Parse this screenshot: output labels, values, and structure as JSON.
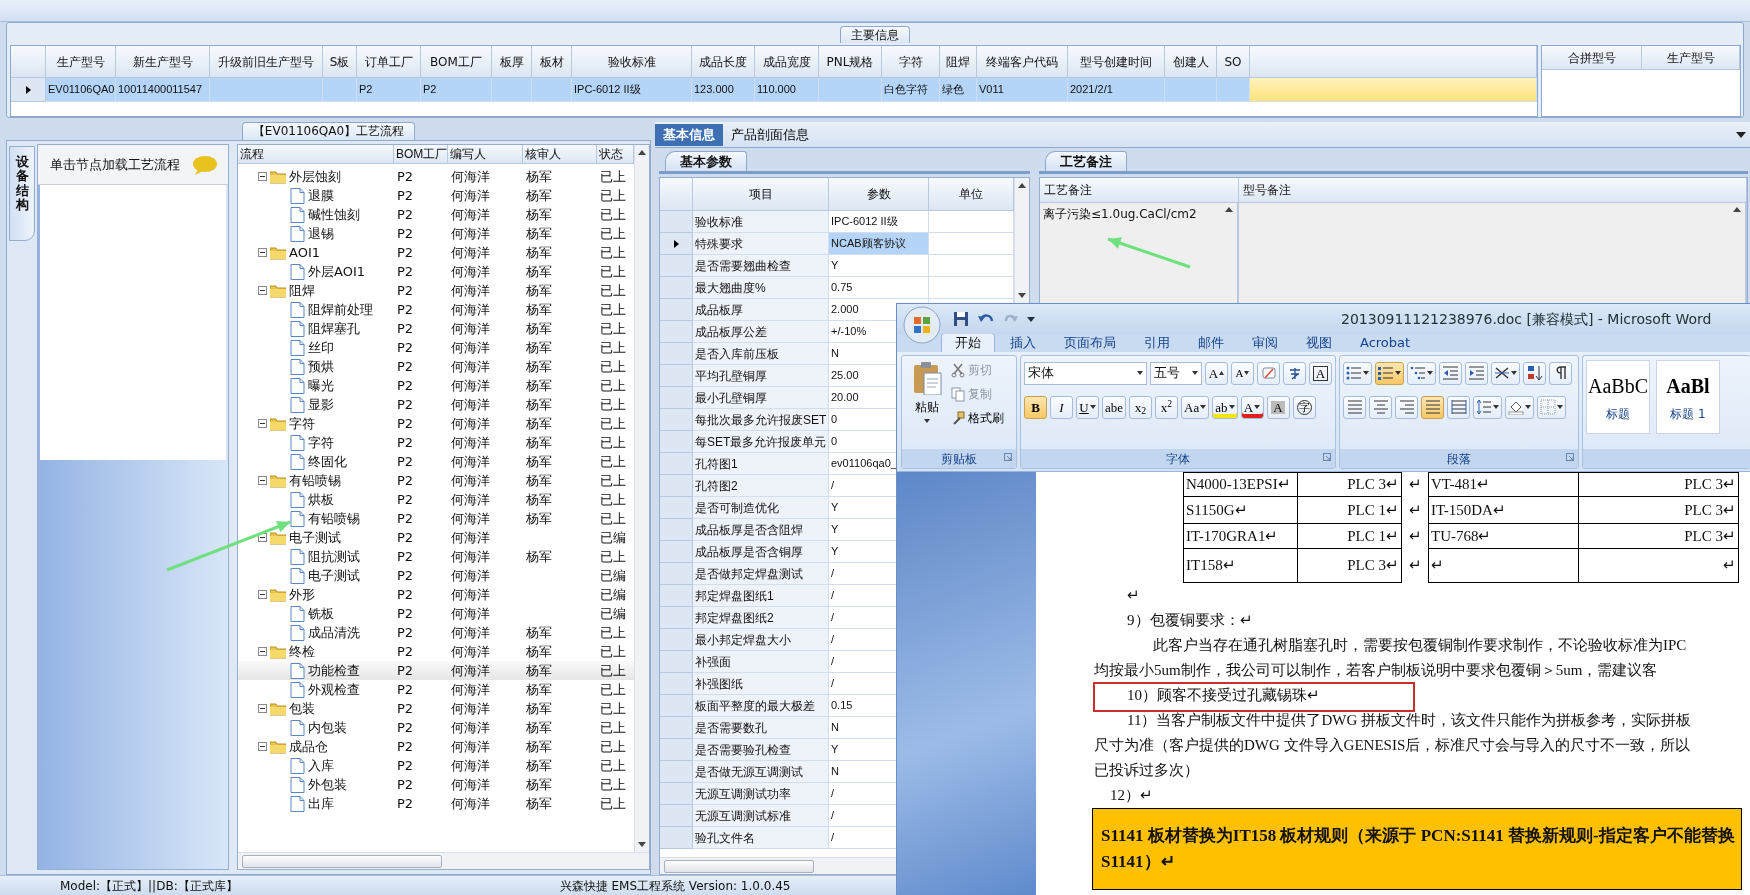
{
  "main_info": {
    "title": "主要信息",
    "row_selected": true,
    "columns": [
      {
        "label": "生产型号",
        "value": "EV01106QA0"
      },
      {
        "label": "新生产型号",
        "value": "10011400011547"
      },
      {
        "label": "升级前旧生产型号"
      },
      {
        "label": "S板"
      },
      {
        "label": "订单工厂",
        "value": "P2"
      },
      {
        "label": "BOM工厂",
        "value": "P2"
      },
      {
        "label": "板厚"
      },
      {
        "label": "板材"
      },
      {
        "label": "验收标准",
        "value": "IPC-6012 II级"
      },
      {
        "label": "成品长度",
        "value": "123.000"
      },
      {
        "label": "成品宽度",
        "value": "110.000"
      },
      {
        "label": "PNL规格"
      },
      {
        "label": "字符",
        "value": "白色字符"
      },
      {
        "label": "阻焊",
        "value": "绿色"
      },
      {
        "label": "终端客户代码",
        "value": "V011"
      },
      {
        "label": "型号创建时间",
        "value": "2021/2/1"
      },
      {
        "label": "创建人"
      },
      {
        "label": "SO"
      }
    ],
    "merge_grid": {
      "columns": [
        "合拼型号",
        "生产型号"
      ]
    }
  },
  "flow": {
    "title": "【EV01106QA0】工艺流程",
    "side_tab": "设备结构",
    "hint": "单击节点加载工艺流程",
    "columns": [
      "流程",
      "BOM工厂",
      "编写人",
      "核审人",
      "状态"
    ],
    "rows": [
      {
        "name": "外层蚀刻",
        "bom": "P2",
        "writer": "何海洋",
        "reviewer": "杨军",
        "status": "已上",
        "selected": false,
        "expanded": true,
        "children": [
          {
            "name": "退膜",
            "bom": "P2",
            "writer": "何海洋",
            "reviewer": "杨军",
            "status": "已上",
            "selected": false
          },
          {
            "name": "碱性蚀刻",
            "bom": "P2",
            "writer": "何海洋",
            "reviewer": "杨军",
            "status": "已上",
            "selected": false
          },
          {
            "name": "退锡",
            "bom": "P2",
            "writer": "何海洋",
            "reviewer": "杨军",
            "status": "已上",
            "selected": false
          }
        ]
      },
      {
        "name": "AOI1",
        "bom": "P2",
        "writer": "何海洋",
        "reviewer": "杨军",
        "status": "已上",
        "selected": false,
        "expanded": true,
        "children": [
          {
            "name": "外层AOI1",
            "bom": "P2",
            "writer": "何海洋",
            "reviewer": "杨军",
            "status": "已上",
            "selected": false
          }
        ]
      },
      {
        "name": "阻焊",
        "bom": "P2",
        "writer": "何海洋",
        "reviewer": "杨军",
        "status": "已上",
        "selected": false,
        "expanded": true,
        "children": [
          {
            "name": "阻焊前处理",
            "bom": "P2",
            "writer": "何海洋",
            "reviewer": "杨军",
            "status": "已上",
            "selected": false
          },
          {
            "name": "阻焊塞孔",
            "bom": "P2",
            "writer": "何海洋",
            "reviewer": "杨军",
            "status": "已上",
            "selected": false
          },
          {
            "name": "丝印",
            "bom": "P2",
            "writer": "何海洋",
            "reviewer": "杨军",
            "status": "已上",
            "selected": false
          },
          {
            "name": "预烘",
            "bom": "P2",
            "writer": "何海洋",
            "reviewer": "杨军",
            "status": "已上",
            "selected": false
          },
          {
            "name": "曝光",
            "bom": "P2",
            "writer": "何海洋",
            "reviewer": "杨军",
            "status": "已上",
            "selected": false
          },
          {
            "name": "显影",
            "bom": "P2",
            "writer": "何海洋",
            "reviewer": "杨军",
            "status": "已上",
            "selected": false
          }
        ]
      },
      {
        "name": "字符",
        "bom": "P2",
        "writer": "何海洋",
        "reviewer": "杨军",
        "status": "已上",
        "selected": false,
        "expanded": true,
        "children": [
          {
            "name": "字符",
            "bom": "P2",
            "writer": "何海洋",
            "reviewer": "杨军",
            "status": "已上",
            "selected": false
          },
          {
            "name": "终固化",
            "bom": "P2",
            "writer": "何海洋",
            "reviewer": "杨军",
            "status": "已上",
            "selected": false
          }
        ]
      },
      {
        "name": "有铅喷锡",
        "bom": "P2",
        "writer": "何海洋",
        "reviewer": "杨军",
        "status": "已上",
        "selected": false,
        "expanded": true,
        "children": [
          {
            "name": "烘板",
            "bom": "P2",
            "writer": "何海洋",
            "reviewer": "杨军",
            "status": "已上",
            "selected": false
          },
          {
            "name": "有铅喷锡",
            "bom": "P2",
            "writer": "何海洋",
            "reviewer": "杨军",
            "status": "已上",
            "selected": false
          }
        ]
      },
      {
        "name": "电子测试",
        "bom": "P2",
        "writer": "何海洋",
        "status": "已编",
        "selected": false,
        "expanded": true,
        "children": [
          {
            "name": "阻抗测试",
            "bom": "P2",
            "writer": "何海洋",
            "reviewer": "杨军",
            "status": "已上",
            "selected": false
          },
          {
            "name": "电子测试",
            "bom": "P2",
            "writer": "何海洋",
            "status": "已编",
            "selected": false
          }
        ]
      },
      {
        "name": "外形",
        "bom": "P2",
        "writer": "何海洋",
        "status": "已编",
        "selected": false,
        "expanded": true,
        "children": [
          {
            "name": "铣板",
            "bom": "P2",
            "writer": "何海洋",
            "status": "已编",
            "selected": false
          },
          {
            "name": "成品清洗",
            "bom": "P2",
            "writer": "何海洋",
            "reviewer": "杨军",
            "status": "已上",
            "selected": false
          }
        ]
      },
      {
        "name": "终检",
        "bom": "P2",
        "writer": "何海洋",
        "reviewer": "杨军",
        "status": "已上",
        "selected": false,
        "expanded": true,
        "children": [
          {
            "name": "功能检查",
            "bom": "P2",
            "writer": "何海洋",
            "reviewer": "杨军",
            "status": "已上",
            "selected": true
          },
          {
            "name": "外观检查",
            "bom": "P2",
            "writer": "何海洋",
            "reviewer": "杨军",
            "status": "已上",
            "selected": false
          }
        ]
      },
      {
        "name": "包装",
        "bom": "P2",
        "writer": "何海洋",
        "reviewer": "杨军",
        "status": "已上",
        "selected": false,
        "expanded": true,
        "children": [
          {
            "name": "内包装",
            "bom": "P2",
            "writer": "何海洋",
            "reviewer": "杨军",
            "status": "已上",
            "selected": false
          }
        ]
      },
      {
        "name": "成品仓",
        "bom": "P2",
        "writer": "何海洋",
        "reviewer": "杨军",
        "status": "已上",
        "selected": false,
        "expanded": true,
        "children": [
          {
            "name": "入库",
            "bom": "P2",
            "writer": "何海洋",
            "reviewer": "杨军",
            "status": "已上",
            "selected": false
          },
          {
            "name": "外包装",
            "bom": "P2",
            "writer": "何海洋",
            "reviewer": "杨军",
            "status": "已上",
            "selected": false
          },
          {
            "name": "出库",
            "bom": "P2",
            "writer": "何海洋",
            "reviewer": "杨军",
            "status": "已上",
            "selected": false
          }
        ]
      }
    ]
  },
  "params": {
    "tabs": [
      {
        "label": "基本信息",
        "selected": true
      },
      {
        "label": "产品剖面信息",
        "selected": false
      }
    ],
    "subtab": "基本参数",
    "columns": [
      "项目",
      "参数",
      "单位"
    ],
    "rows": [
      {
        "item": "验收标准",
        "value": "IPC-6012 II级",
        "selected": false
      },
      {
        "item": "特殊要求",
        "value": "NCAB顾客协议",
        "selected": true
      },
      {
        "item": "是否需要翘曲检查",
        "value": "Y",
        "selected": false
      },
      {
        "item": "最大翘曲度%",
        "value": "0.75",
        "selected": false
      },
      {
        "item": "成品板厚",
        "value": "2.000",
        "selected": false
      },
      {
        "item": "成品板厚公差",
        "value": "+/-10%",
        "selected": false
      },
      {
        "item": "是否入库前压板",
        "value": "N",
        "selected": false
      },
      {
        "item": "平均孔壁铜厚",
        "value": "25.00",
        "selected": false
      },
      {
        "item": "最小孔壁铜厚",
        "value": "20.00",
        "selected": false
      },
      {
        "item": "每批次最多允许报废SET",
        "value": "0",
        "selected": false
      },
      {
        "item": "每SET最多允许报废单元",
        "value": "0",
        "selected": false
      },
      {
        "item": "孔符图1",
        "value": "ev01106qa0_",
        "selected": false
      },
      {
        "item": "孔符图2",
        "value": "/",
        "selected": false
      },
      {
        "item": "是否可制造优化",
        "value": "Y",
        "selected": false
      },
      {
        "item": "成品板厚是否含阻焊",
        "value": "Y",
        "selected": false
      },
      {
        "item": "成品板厚是否含铜厚",
        "value": "Y",
        "selected": false
      },
      {
        "item": "是否做邦定焊盘测试",
        "value": "/",
        "selected": false
      },
      {
        "item": "邦定焊盘图纸1",
        "value": "/",
        "selected": false
      },
      {
        "item": "邦定焊盘图纸2",
        "value": "/",
        "selected": false
      },
      {
        "item": "最小邦定焊盘大小",
        "value": "/",
        "selected": false
      },
      {
        "item": "补强面",
        "value": "/",
        "selected": false
      },
      {
        "item": "补强图纸",
        "value": "/",
        "selected": false
      },
      {
        "item": "板面平整度的最大极差",
        "value": "0.15",
        "selected": false
      },
      {
        "item": "是否需要数孔",
        "value": "N",
        "selected": false
      },
      {
        "item": "是否需要验孔检查",
        "value": "Y",
        "selected": false
      },
      {
        "item": "是否做无源互调测试",
        "value": "N",
        "selected": false
      },
      {
        "item": "无源互调测试功率",
        "value": "/",
        "selected": false
      },
      {
        "item": "无源互调测试标准",
        "value": "/",
        "selected": false
      },
      {
        "item": "验孔文件名",
        "value": "/",
        "selected": false
      }
    ]
  },
  "notes": {
    "tab": "工艺备注",
    "columns": [
      "工艺备注",
      "型号备注"
    ],
    "process_note": "离子污染≤1.0ug.CaCl/cm2"
  },
  "status_bar": {
    "left": "Model:【正式】||DB:【正式库】",
    "center": "兴森快捷 EMS工程系统 Version: 1.0.0.45"
  },
  "word": {
    "title": "20130911121238976.doc [兼容模式] - Microsoft Word",
    "tabs": [
      {
        "label": "开始",
        "selected": true
      },
      {
        "label": "插入",
        "selected": false
      },
      {
        "label": "页面布局",
        "selected": false
      },
      {
        "label": "引用",
        "selected": false
      },
      {
        "label": "邮件",
        "selected": false
      },
      {
        "label": "审阅",
        "selected": false
      },
      {
        "label": "视图",
        "selected": false
      },
      {
        "label": "Acrobat",
        "selected": false
      }
    ],
    "groups": [
      "剪贴板",
      "字体",
      "段落"
    ],
    "clipboard": {
      "paste": "粘贴",
      "items": [
        {
          "kind": "cut",
          "label": "剪切",
          "disabled": true
        },
        {
          "kind": "copy",
          "label": "复制",
          "disabled": true
        },
        {
          "kind": "format-painter",
          "label": "格式刷",
          "disabled": false
        }
      ]
    },
    "font": {
      "name": "宋体",
      "size": "五号",
      "row1": [
        {
          "kind": "grow-font",
          "label": "A",
          "on": false
        },
        {
          "kind": "shrink-font",
          "label": "A",
          "on": false
        },
        {
          "kind": "clear-format",
          "on": false
        },
        {
          "kind": "phonetic-guide",
          "on": false
        },
        {
          "kind": "character-border",
          "label": "A",
          "on": false
        }
      ],
      "row2": [
        {
          "kind": "bold",
          "label": "B",
          "on": true
        },
        {
          "kind": "italic",
          "label": "I",
          "on": false
        },
        {
          "kind": "underline",
          "label": "U",
          "on": false
        },
        {
          "kind": "strikethrough",
          "label": "abe",
          "on": false
        },
        {
          "kind": "subscript",
          "label": "x$_{2}$",
          "on": false
        },
        {
          "kind": "superscript",
          "label": "x$^{2}$",
          "on": false
        },
        {
          "kind": "change-case",
          "label": "Aa",
          "on": false
        },
        {
          "kind": "highlight",
          "label": "ab",
          "on": false
        },
        {
          "kind": "font-color",
          "label": "A",
          "on": false
        },
        {
          "kind": "character-shading",
          "label": "A",
          "on": false
        },
        {
          "kind": "enclose-characters",
          "label": "字",
          "on": false
        }
      ]
    },
    "paragraph": {
      "row1": [
        {
          "kind": "bullets",
          "on": false
        },
        {
          "kind": "numbering",
          "on": true
        },
        {
          "kind": "multilevel-list",
          "on": false
        },
        {
          "kind": "decrease-indent",
          "on": false
        },
        {
          "kind": "increase-indent",
          "on": false
        },
        {
          "kind": "chinese-layout",
          "on": false
        },
        {
          "kind": "sort",
          "on": false
        },
        {
          "kind": "show-marks",
          "on": false
        }
      ],
      "row2": [
        {
          "kind": "align-left",
          "on": false
        },
        {
          "kind": "align-center",
          "on": false
        },
        {
          "kind": "align-right",
          "on": false
        },
        {
          "kind": "justify",
          "on": true
        },
        {
          "kind": "distributed",
          "on": false
        },
        {
          "kind": "line-spacing",
          "on": false
        },
        {
          "kind": "shading",
          "on": false
        },
        {
          "kind": "borders",
          "on": false
        }
      ]
    },
    "styles": [
      {
        "sample": "AaBbC",
        "label": "标题"
      },
      {
        "sample": "AaBl",
        "label": "标题 1"
      }
    ],
    "doc": {
      "table_rows": [
        [
          "N4000-13EPSI↵",
          "PLC 3↵",
          "↵",
          "VT-481↵",
          "PLC 3↵"
        ],
        [
          "S1150G↵",
          "PLC 1↵",
          "↵",
          "IT-150DA↵",
          "PLC 3↵"
        ],
        [
          "IT-170GRA1↵",
          "PLC 1↵",
          "↵",
          "TU-768↵",
          "PLC 3↵"
        ],
        [
          "IT158↵",
          "PLC 3↵",
          "↵",
          "↵",
          "↵"
        ]
      ],
      "paragraphs": [
        {
          "kind": "item",
          "text": "↵"
        },
        {
          "kind": "item",
          "text": "9）包覆铜要求：↵"
        },
        {
          "kind": "first",
          "text": "此客户当存在通孔树脂塞孔时，需要按包覆铜制作要求制作，不论验收标准为IPC"
        },
        {
          "kind": "cont",
          "text": "均按最小5um制作，我公司可以制作，若客户制板说明中要求包覆铜＞5um，需建议客"
        },
        {
          "kind": "boxed",
          "text": "10）顾客不接受过孔藏锡珠↵"
        },
        {
          "kind": "item",
          "text": "11）当客户制板文件中提供了DWG 拼板文件时，该文件只能作为拼板参考，实际拼板"
        },
        {
          "kind": "cont",
          "text": "尺寸为准（客户提供的DWG 文件导入GENESIS后，标准尺寸会与导入的尺寸不一致，所以"
        },
        {
          "kind": "cont",
          "text": "已投诉过多次）"
        },
        {
          "kind": "short",
          "text": "12）↵"
        }
      ],
      "banner": "S1141 板材替换为IT158 板材规则（来源于 PCN:S1141 替换新规则-指定客户不能替换 S1141）↵"
    }
  }
}
